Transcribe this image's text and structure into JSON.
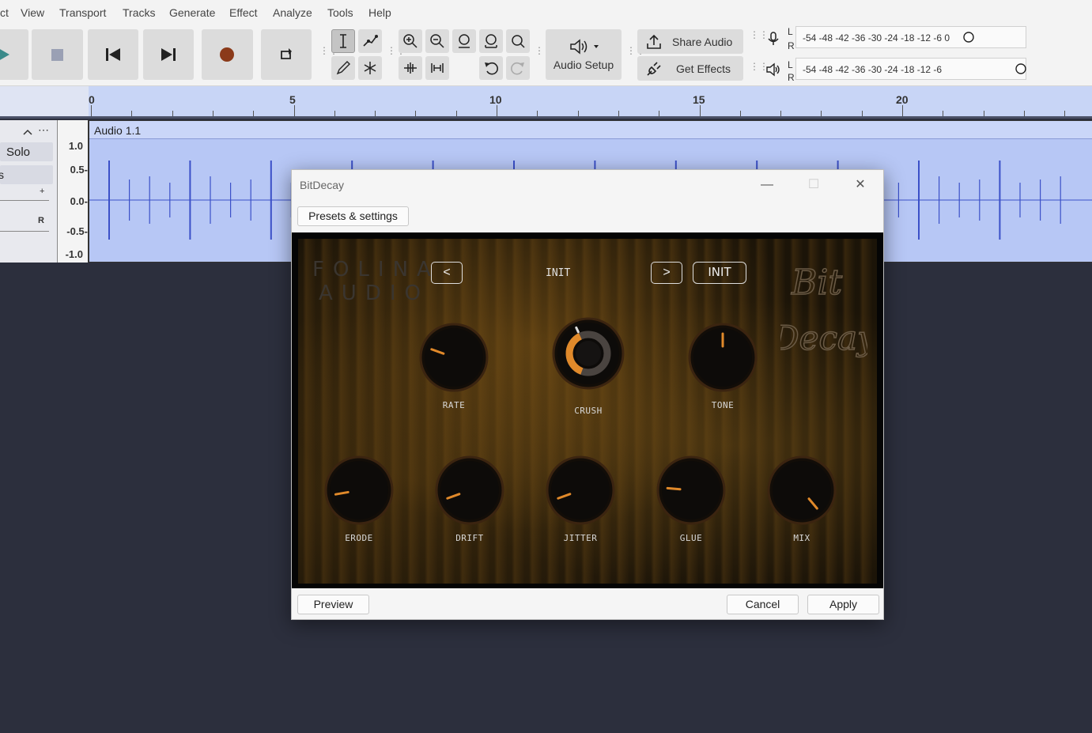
{
  "menu": [
    "ct",
    "View",
    "Transport",
    "Tracks",
    "Generate",
    "Effect",
    "Analyze",
    "Tools",
    "Help"
  ],
  "toolbar": {
    "share_audio": "Share Audio",
    "get_effects": "Get Effects",
    "audio_setup": "Audio Setup",
    "meter_record_ticks": "-54  -48  -42  -36  -30  -24  -18  -12   -6    0",
    "meter_play_ticks": "-54  -48  -42  -36  -30  -24  -18  -12   -6",
    "meter_L": "L",
    "meter_R": "R"
  },
  "timeline": {
    "labels": [
      "0",
      "5",
      "10",
      "15",
      "20"
    ]
  },
  "track": {
    "name": "Audio 1.1",
    "solo_label": "Solo",
    "left_cut_label": "s",
    "pan_r_label": "R",
    "gain_plus_label": "+",
    "scale": [
      "1.0",
      "0.5-",
      "0.0-",
      "-0.5-",
      "-1.0"
    ]
  },
  "dialog": {
    "title": "BitDecay",
    "presets_button": "Presets & settings",
    "preview_button": "Preview",
    "cancel_button": "Cancel",
    "apply_button": "Apply",
    "minimize": "—",
    "maximize": "☐",
    "close": "✕"
  },
  "plugin": {
    "brand_line1": "FOLINA",
    "brand_line2": "AUDIO",
    "prev_button": "<",
    "next_button": ">",
    "preset_name": "INIT",
    "init_button": "INIT",
    "logo_line1": "Bit",
    "logo_line2": "Decay",
    "knobs": [
      {
        "label": "RATE",
        "angle": -70
      },
      {
        "label": "CRUSH",
        "angle": -25
      },
      {
        "label": "TONE",
        "angle": 0
      },
      {
        "label": "ERODE",
        "angle": -100
      },
      {
        "label": "DRIFT",
        "angle": -110
      },
      {
        "label": "JITTER",
        "angle": -110
      },
      {
        "label": "GLUE",
        "angle": -85
      },
      {
        "label": "MIX",
        "angle": 140
      }
    ]
  },
  "colors": {
    "accent_knob": "#e0892a",
    "track_bg": "#b7c7f5",
    "ruler_bg": "#c8d5f6",
    "wave": "#3b50c8",
    "record_red": "#8b3a1a"
  }
}
